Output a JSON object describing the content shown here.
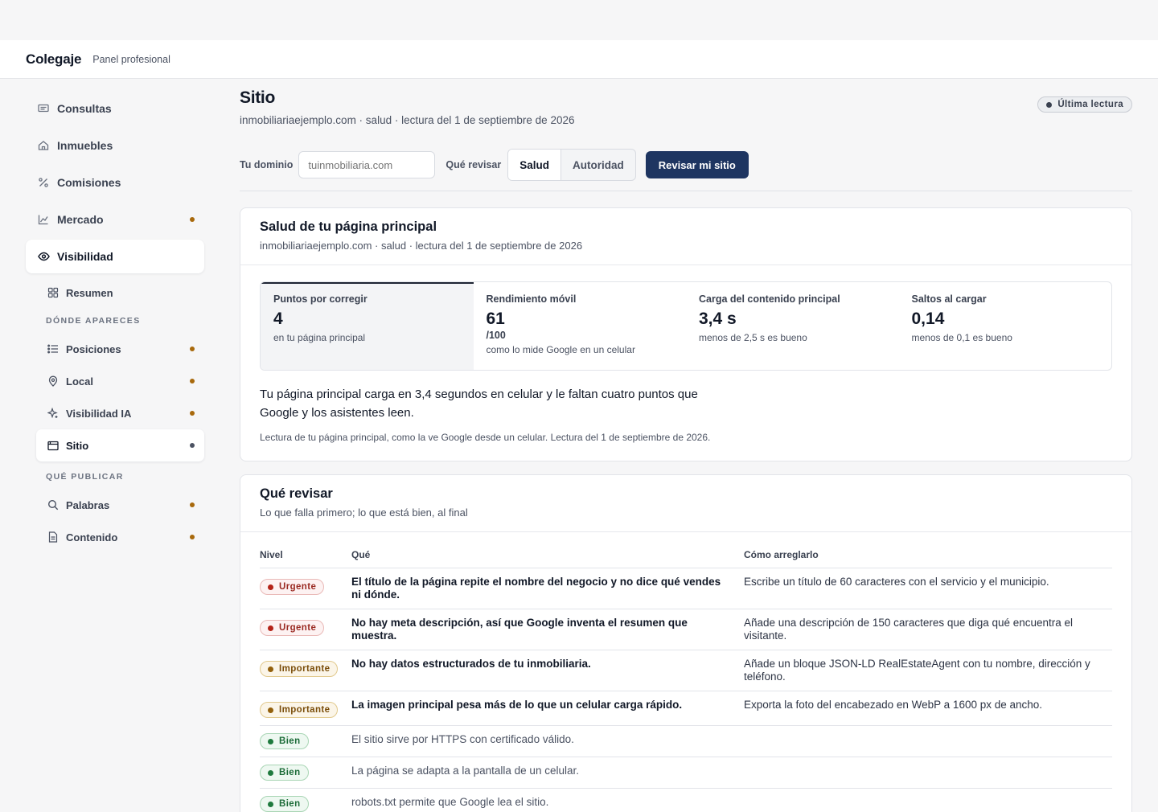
{
  "header": {
    "brand": "Colegaje",
    "subtitle": "Panel profesional"
  },
  "sidebar": {
    "items": [
      {
        "label": "Consultas",
        "icon": "message-icon",
        "dot": false
      },
      {
        "label": "Inmuebles",
        "icon": "home-icon",
        "dot": false
      },
      {
        "label": "Comisiones",
        "icon": "percent-icon",
        "dot": false
      },
      {
        "label": "Mercado",
        "icon": "chart-icon",
        "dot": true
      },
      {
        "label": "Visibilidad",
        "icon": "eye-icon",
        "active": true
      }
    ],
    "sub": {
      "resumen": "Resumen",
      "section_donde": "DÓNDE APARECES",
      "posiciones": "Posiciones",
      "local": "Local",
      "visibilidad_ia": "Visibilidad IA",
      "sitio": "Sitio",
      "section_publicar": "QUÉ PUBLICAR",
      "palabras": "Palabras",
      "contenido": "Contenido"
    }
  },
  "page": {
    "title": "Sitio",
    "subtitle": "inmobiliariaejemplo.com · salud · lectura del 1 de septiembre de 2026",
    "badge": "Última lectura"
  },
  "controls": {
    "domain_label": "Tu dominio",
    "domain_placeholder": "tuinmobiliaria.com",
    "review_label": "Qué revisar",
    "seg_health": "Salud",
    "seg_authority": "Autoridad",
    "submit": "Revisar mi sitio"
  },
  "health": {
    "title": "Salud de tu página principal",
    "subtitle": "inmobiliariaejemplo.com · salud · lectura del 1 de septiembre de 2026",
    "metrics": [
      {
        "label": "Puntos por corregir",
        "value": "4",
        "unit": "",
        "note": "en tu página principal"
      },
      {
        "label": "Rendimiento móvil",
        "value": "61",
        "unit": "/100",
        "note": "como lo mide Google en un celular"
      },
      {
        "label": "Carga del contenido principal",
        "value": "3,4 s",
        "unit": "",
        "note": "menos de 2,5 s es bueno"
      },
      {
        "label": "Saltos al cargar",
        "value": "0,14",
        "unit": "",
        "note": "menos de 0,1 es bueno"
      }
    ],
    "summary": "Tu página principal carga en 3,4 segundos en celular y le faltan cuatro puntos que Google y los asistentes leen.",
    "footnote": "Lectura de tu página principal, como la ve Google desde un celular. Lectura del 1 de septiembre de 2026."
  },
  "review": {
    "title": "Qué revisar",
    "subtitle": "Lo que falla primero; lo que está bien, al final",
    "columns": {
      "level": "Nivel",
      "what": "Qué",
      "how": "Cómo arreglarlo"
    },
    "rows": [
      {
        "level": "Urgente",
        "what": "El título de la página repite el nombre del negocio y no dice qué vendes ni dónde.",
        "how": "Escribe un título de 60 caracteres con el servicio y el municipio."
      },
      {
        "level": "Urgente",
        "what": "No hay meta descripción, así que Google inventa el resumen que muestra.",
        "how": "Añade una descripción de 150 caracteres que diga qué encuentra el visitante."
      },
      {
        "level": "Importante",
        "what": "No hay datos estructurados de tu inmobiliaria.",
        "how": "Añade un bloque JSON-LD RealEstateAgent con tu nombre, dirección y teléfono."
      },
      {
        "level": "Importante",
        "what": "La imagen principal pesa más de lo que un celular carga rápido.",
        "how": "Exporta la foto del encabezado en WebP a 1600 px de ancho."
      },
      {
        "level": "Bien",
        "what": "El sitio sirve por HTTPS con certificado válido.",
        "how": ""
      },
      {
        "level": "Bien",
        "what": "La página se adapta a la pantalla de un celular.",
        "how": ""
      },
      {
        "level": "Bien",
        "what": "robots.txt permite que Google lea el sitio.",
        "how": ""
      }
    ]
  },
  "colors": {
    "accent": "#1e3561",
    "dot": "#a8690c",
    "urgent": "#b42318",
    "important": "#93600c",
    "good": "#1f7a3e"
  }
}
